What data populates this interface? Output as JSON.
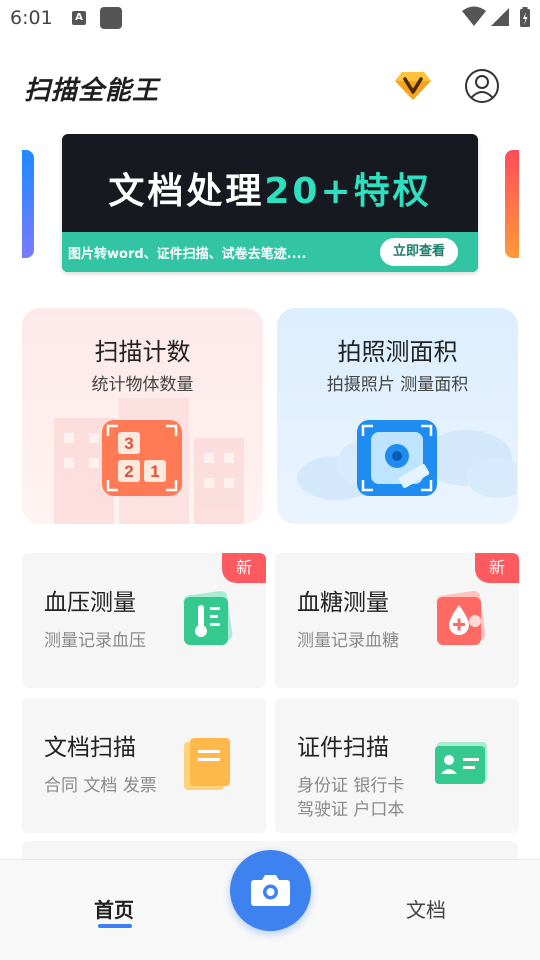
{
  "status_bar": {
    "time": "6:01",
    "notification_letter": "A"
  },
  "header": {
    "app_title": "扫描全能王",
    "icons": [
      "vip-diamond-icon",
      "user-account-icon"
    ]
  },
  "banner": {
    "title_main": "文档处理",
    "title_accent": "20+特权",
    "subtitle": "图片转word、证件扫描、试卷去笔迹....",
    "button_label": "立即查看",
    "colors": {
      "bg": "#16191f",
      "accent": "#2ee0c0",
      "strip": "#33c4a4"
    }
  },
  "feature_cards": [
    {
      "title": "扫描计数",
      "subtitle": "统计物体数量",
      "icon": "counter-icon",
      "counter_digits": [
        "3",
        "2",
        "1"
      ]
    },
    {
      "title": "拍照测面积",
      "subtitle": "拍摄照片 测量面积",
      "icon": "camera-measure-icon"
    }
  ],
  "tools": [
    {
      "title": "血压测量",
      "subtitle": "测量记录血压",
      "badge": "新",
      "icon": "thermometer-icon"
    },
    {
      "title": "血糖测量",
      "subtitle": "测量记录血糖",
      "badge": "新",
      "icon": "blood-drop-icon"
    },
    {
      "title": "文档扫描",
      "subtitle": "合同 文档 发票",
      "icon": "document-icon"
    },
    {
      "title": "证件扫描",
      "subtitle_line1": "身份证 银行卡",
      "subtitle_line2": "驾驶证 户口本",
      "icon": "id-card-icon"
    }
  ],
  "bottom_nav": {
    "home_label": "首页",
    "docs_label": "文档",
    "camera_icon": "camera-icon",
    "active": "home",
    "accent_color": "#3b7ff5"
  }
}
